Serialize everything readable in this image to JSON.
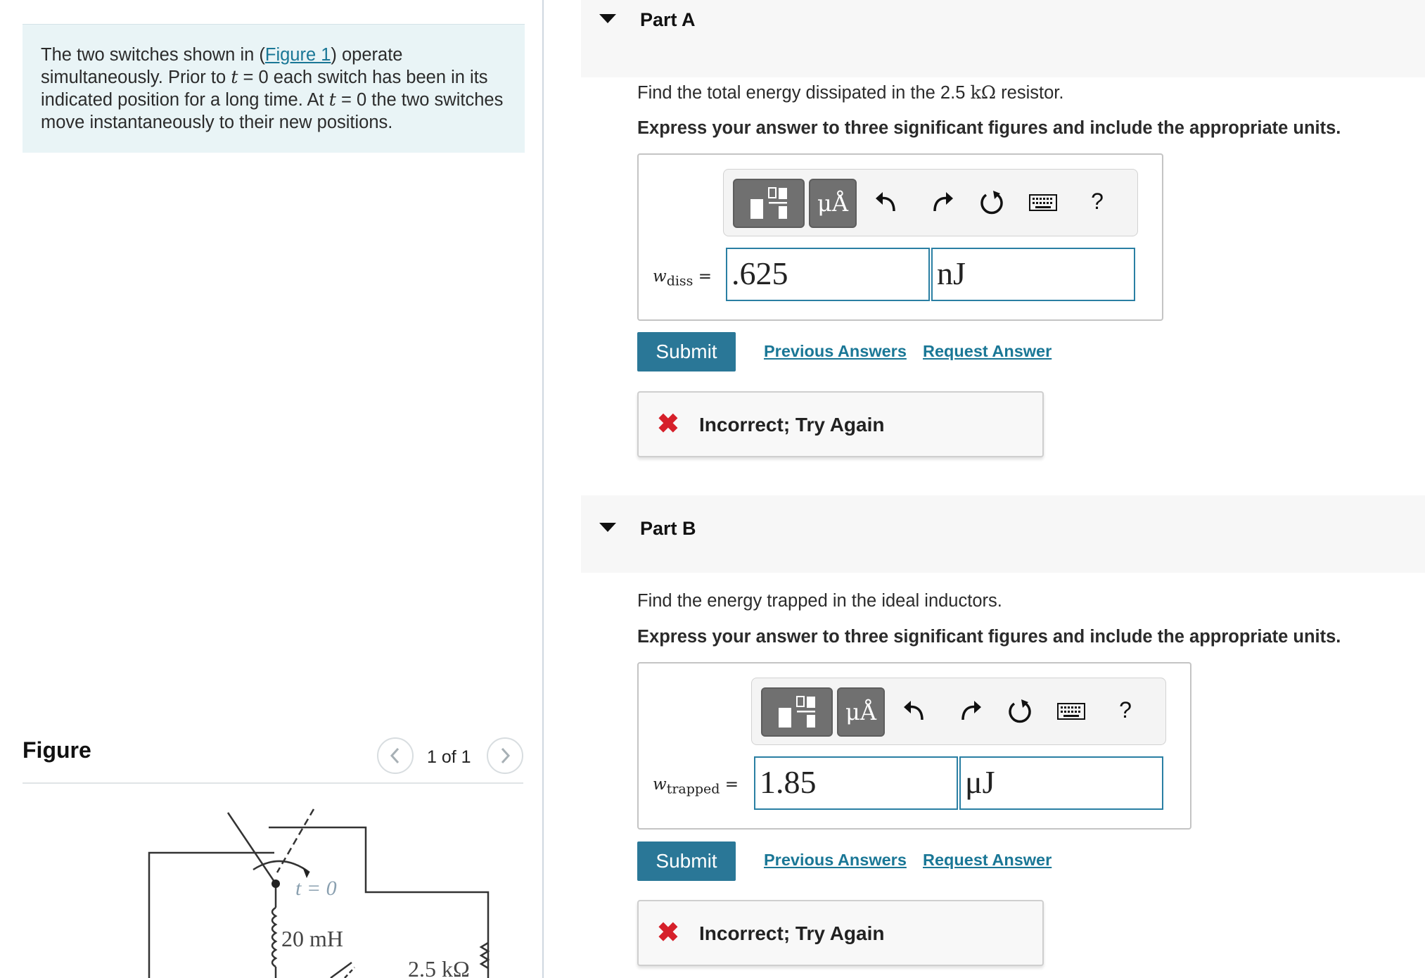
{
  "problem": {
    "text_1": "The two switches shown in (",
    "figure_link": "Figure 1",
    "text_2": ") operate simultaneously. Prior to ",
    "var_t": "t",
    "text_3": " = 0 each switch has been in its indicated position for a long time. At ",
    "text_4": " = 0 the two switches move instantaneously to their new positions."
  },
  "figure": {
    "heading": "Figure",
    "counter": "1 of 1",
    "prev_icon": "chevron-left-icon",
    "next_icon": "chevron-right-icon",
    "labels": {
      "switch_time": "t = 0",
      "inductor": "20 mH",
      "resistor": "2.5 kΩ"
    }
  },
  "parts": [
    {
      "title": "Part A",
      "prompt_pre": "Find the total energy dissipated in the 2.5 ",
      "prompt_unit": "kΩ",
      "prompt_post": " resistor.",
      "instruction": "Express your answer to three significant figures and include the appropriate units.",
      "variable": "w",
      "variable_sub": "diss",
      "value": ".625",
      "units": "nJ",
      "submit_label": "Submit",
      "previous_answers": "Previous Answers",
      "request_answer": "Request Answer",
      "feedback": "Incorrect; Try Again"
    },
    {
      "title": "Part B",
      "prompt_pre": "Find the energy trapped in the ideal inductors.",
      "prompt_unit": "",
      "prompt_post": "",
      "instruction": "Express your answer to three significant figures and include the appropriate units.",
      "variable": "w",
      "variable_sub": "trapped",
      "value": "1.85",
      "units": "μJ",
      "submit_label": "Submit",
      "previous_answers": "Previous Answers",
      "request_answer": "Request Answer",
      "feedback": "Incorrect; Try Again"
    }
  ],
  "toolbar": {
    "units_label": "μÅ",
    "help": "?",
    "icons": [
      "templates-icon",
      "units-icon",
      "undo-icon",
      "redo-icon",
      "reset-icon",
      "keyboard-icon",
      "help-icon"
    ]
  },
  "colors": {
    "accent": "#2a7797",
    "link": "#1a7796",
    "error": "#d6202a",
    "problem_bg": "#e9f4f6"
  }
}
